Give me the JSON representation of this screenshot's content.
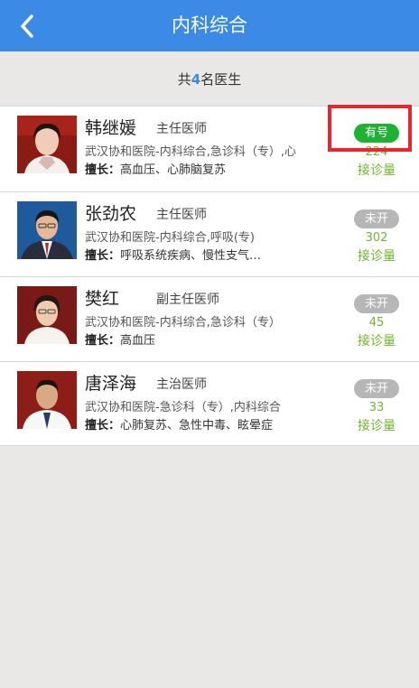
{
  "header": {
    "title": "内科综合",
    "back_icon": "chevron-left-icon"
  },
  "summary": {
    "prefix": "共",
    "count": "4",
    "suffix": "名医生"
  },
  "skill_label": "擅长：",
  "visits_label": "接诊量",
  "colors": {
    "header": "#3b8be6",
    "open_badge": "#1fb134",
    "closed_badge": "#b6b6b6",
    "visits": "#6cb62c",
    "highlight": "#e8262c"
  },
  "doctors": [
    {
      "name": "韩继媛",
      "title": "主任医师",
      "dept": "武汉协和医院-内科综合,急诊科（专）,心",
      "skill": "高血压、心肺脑复苏",
      "status": "有号",
      "visits": "224"
    },
    {
      "name": "张劲农",
      "title": "主任医师",
      "dept": "武汉协和医院-内科综合,呼吸(专)",
      "skill": "呼吸系统疾病、慢性支气…",
      "status": "未开",
      "visits": "302"
    },
    {
      "name": "樊红",
      "title": "副主任医师",
      "dept": "武汉协和医院-内科综合,急诊科（专）",
      "skill": "高血压",
      "status": "未开",
      "visits": "45"
    },
    {
      "name": "唐泽海",
      "title": "主治医师",
      "dept": "武汉协和医院-急诊科（专）,内科综合",
      "skill": "心肺复苏、急性中毒、眩晕症",
      "status": "未开",
      "visits": "33"
    }
  ]
}
